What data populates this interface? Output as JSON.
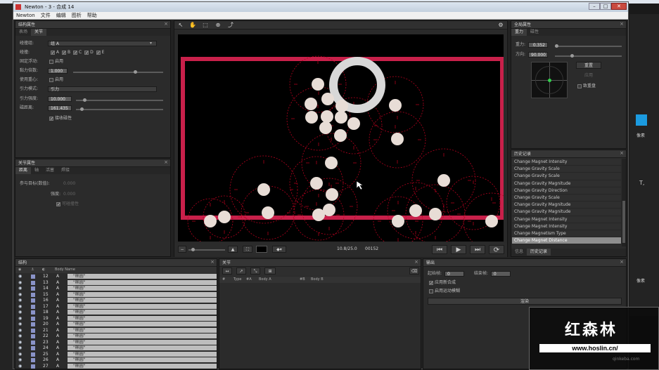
{
  "window": {
    "title": "Newton - 3 - 合成 14",
    "menu": [
      "Newton",
      "文件",
      "编辑",
      "图析",
      "帮助"
    ],
    "controls": [
      "–",
      "□",
      "✕"
    ]
  },
  "body_props": {
    "title": "结构属性",
    "tabs": [
      "表场",
      "关节"
    ],
    "active_tab": 1,
    "rows": [
      {
        "label": "碰撞组:",
        "value": "组 A"
      },
      {
        "label": "碰撞:",
        "checks": [
          "A",
          "B",
          "C",
          "D",
          "E"
        ]
      },
      {
        "label": "固定浮动:",
        "check_label": "启用"
      },
      {
        "label": "黏力倍数:",
        "value": "1.000"
      },
      {
        "label": "使用重心:",
        "check_label": "启用"
      },
      {
        "label": "引力模式:",
        "value": "引力"
      },
      {
        "label": "引力强度:",
        "value": "10.000"
      },
      {
        "label": "磁距离:",
        "value": "161.435"
      },
      {
        "label": "",
        "check_label": "接收磁性"
      }
    ]
  },
  "joint_props": {
    "title": "关节属性",
    "tabs": [
      "距离",
      "轴",
      "活塞",
      "焊接"
    ],
    "rows": [
      {
        "label": "参与目标(数值):",
        "value": "0.000"
      },
      {
        "label": "强度:",
        "value": "0.000"
      },
      {
        "label": "",
        "check_label": "可碰撞性"
      }
    ]
  },
  "toolbar": {
    "tools": [
      "↖",
      "✋",
      "⬚",
      "⊕",
      "⤴"
    ]
  },
  "viewport": {
    "time": "10.8/25.0",
    "frame": "00152",
    "playback": [
      "⏮",
      "▶",
      "⏭",
      "⟳"
    ]
  },
  "world_props": {
    "title": "全局属性",
    "tabs": [
      "重力",
      "磁性"
    ],
    "gravity_label": "重力:",
    "gravity_value": "0.352",
    "direction_label": "方向:",
    "direction_value": "90.000",
    "btn_label": "重置",
    "btn2_label": "应用",
    "check_label": "致重盘"
  },
  "history": {
    "title": "历史记录",
    "items": [
      "Change Magnet Intensity",
      "Change Gravity Scale",
      "Change Gravity Scale",
      "Change Gravity Magnitude",
      "Change Gravity Direction",
      "Change Gravity Scale",
      "Change Gravity Magnitude",
      "Change Gravity Magnitude",
      "Change Magnet Intensity",
      "Change Magnet Intensity",
      "Change Magnetism Type",
      "Change Magnet Distance"
    ],
    "selected_index": 11,
    "bottom_tabs": [
      "信息",
      "历史记录"
    ]
  },
  "structure": {
    "title": "结构",
    "col_name": "Body Name",
    "rows": [
      {
        "num": "12",
        "type": "A",
        "name": "\"椭圆\""
      },
      {
        "num": "13",
        "type": "A",
        "name": "\"椭圆\""
      },
      {
        "num": "14",
        "type": "A",
        "name": "\"椭圆\""
      },
      {
        "num": "15",
        "type": "A",
        "name": "\"椭圆\""
      },
      {
        "num": "16",
        "type": "A",
        "name": "\"椭圆\""
      },
      {
        "num": "17",
        "type": "A",
        "name": "\"椭圆\""
      },
      {
        "num": "18",
        "type": "A",
        "name": "\"椭圆\""
      },
      {
        "num": "19",
        "type": "A",
        "name": "\"椭圆\""
      },
      {
        "num": "20",
        "type": "A",
        "name": "\"椭圆\""
      },
      {
        "num": "21",
        "type": "A",
        "name": "\"椭圆\""
      },
      {
        "num": "22",
        "type": "A",
        "name": "\"椭圆\""
      },
      {
        "num": "23",
        "type": "A",
        "name": "\"椭圆\""
      },
      {
        "num": "24",
        "type": "A",
        "name": "\"椭圆\""
      },
      {
        "num": "25",
        "type": "A",
        "name": "\"椭圆\""
      },
      {
        "num": "26",
        "type": "A",
        "name": "\"椭圆\""
      },
      {
        "num": "27",
        "type": "A",
        "name": "\"椭圆\""
      }
    ]
  },
  "joints": {
    "title": "关节",
    "columns": [
      "#",
      "Type",
      "#A",
      "Body A",
      "#B",
      "Body B"
    ]
  },
  "output": {
    "title": "输出",
    "start_label": "起始帧:",
    "start_value": "0",
    "end_label": "结束帧:",
    "end_value": "0",
    "check1": "应用新合成",
    "check2": "启用运动模糊",
    "render_label": "渲染"
  },
  "watermark": {
    "brand": "红森林",
    "url": "www.hoslin.cn/",
    "site": "qinkeba.com"
  },
  "ae_side": {
    "labels": [
      "像素",
      "像素"
    ]
  }
}
